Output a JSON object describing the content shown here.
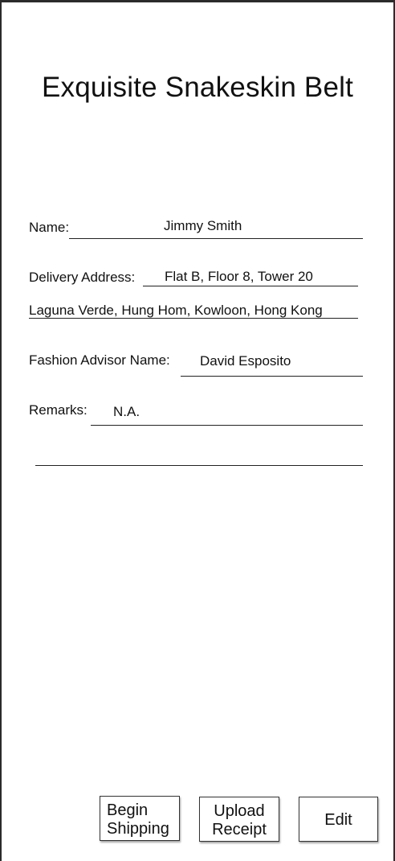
{
  "page": {
    "title": "Exquisite Snakeskin Belt"
  },
  "form": {
    "name_label": "Name:",
    "name_value": "Jimmy Smith",
    "address_label": "Delivery Address:",
    "address_line1": "Flat B,  Floor 8, Tower 20",
    "address_line2": "Laguna Verde, Hung Hom, Kowloon, Hong Kong",
    "advisor_label": "Fashion Advisor Name:",
    "advisor_value": "David Esposito",
    "remarks_label": "Remarks:",
    "remarks_value": "N.A."
  },
  "actions": {
    "begin_shipping_line1": "Begin",
    "begin_shipping_line2": "Shipping",
    "upload_receipt_line1": "Upload",
    "upload_receipt_line2": "Receipt",
    "edit_label": "Edit"
  }
}
